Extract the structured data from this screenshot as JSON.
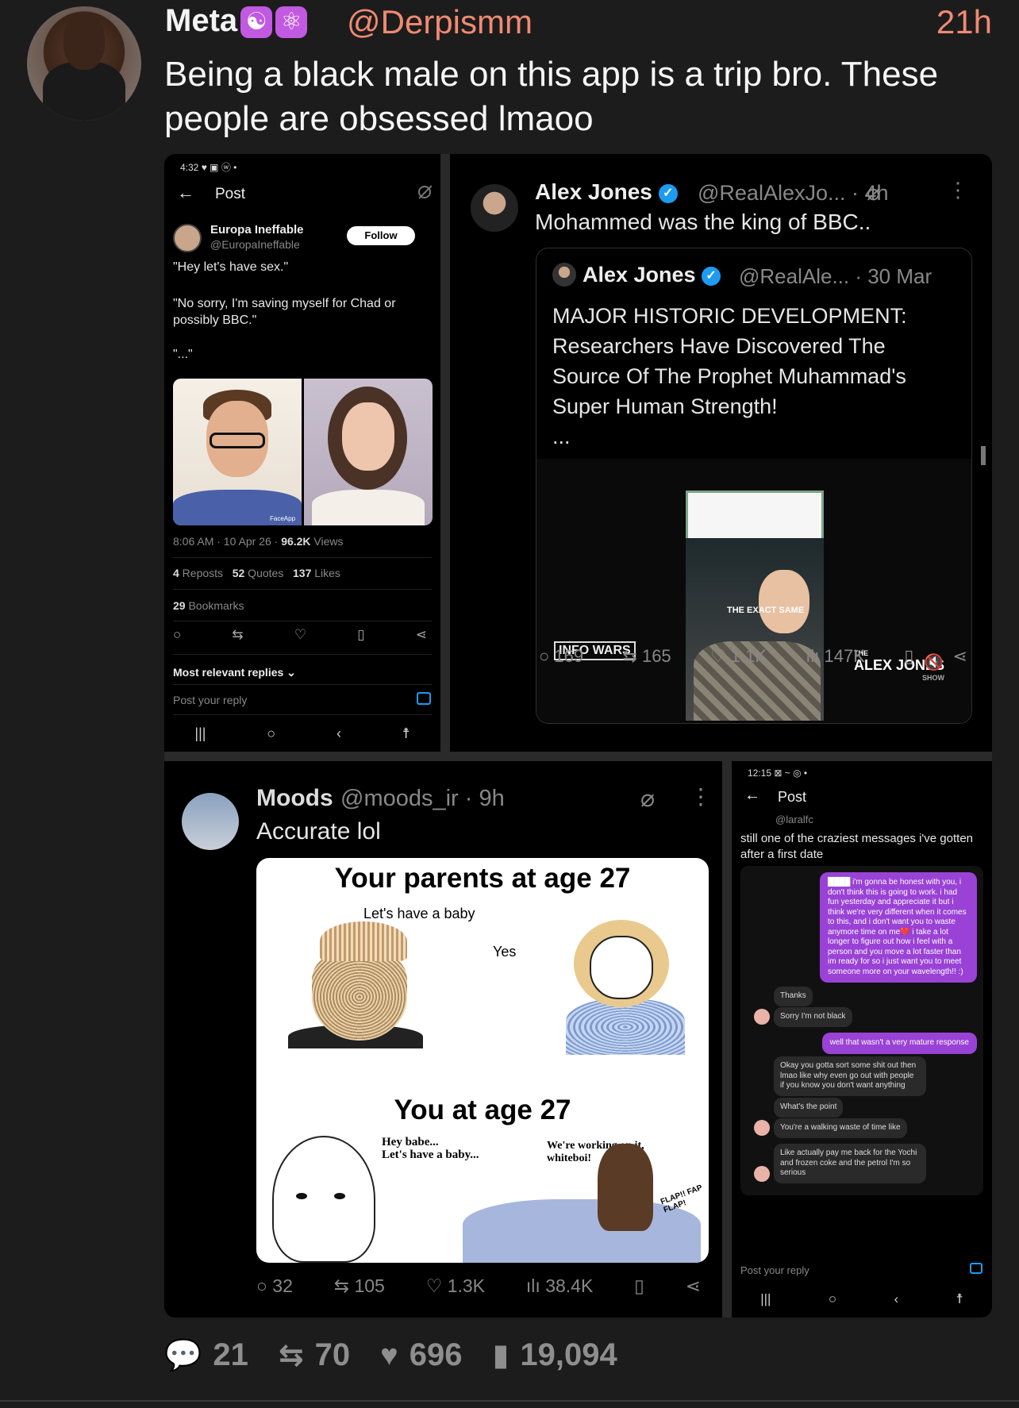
{
  "post": {
    "username": "Meta",
    "badges": [
      "☯",
      "⚛"
    ],
    "handle": "@Derpismm",
    "time": "21h",
    "text": "Being a black male on this app is a trip bro. These people are obsessed lmaoo"
  },
  "panel1": {
    "status_bar": "4:32 ♥ ▣ ⓦ •",
    "title": "Post",
    "author_name": "Europa Ineffable",
    "author_handle": "@EuropaIneffable",
    "follow_label": "Follow",
    "body1": "\"Hey let's have sex.\"",
    "body2": "\"No sorry, I'm saving myself for Chad or possibly BBC.\"",
    "body3": "\"...\"",
    "image_watermark": "FaceApp",
    "meta_time": "8:06 AM · 10 Apr 26 · ",
    "views_value": "96.2K",
    "views_label": " Views",
    "reposts_value": "4",
    "reposts_label": " Reposts",
    "quotes_value": "52",
    "quotes_label": " Quotes",
    "likes_value": "137",
    "likes_label": " Likes",
    "bookmarks_value": "29",
    "bookmarks_label": " Bookmarks",
    "replies_filter": "Most relevant replies ⌄",
    "reply_placeholder": "Post your reply"
  },
  "panel2": {
    "author_name": "Alex Jones",
    "author_handle": "@RealAlexJo... · 4h",
    "text": "Mohammed was the king of BBC..",
    "quote_name": "Alex Jones",
    "quote_handle": "@RealAle... · 30 Mar",
    "quote_text": "MAJOR HISTORIC DEVELOPMENT: Researchers Have Discovered The Source Of The Prophet Muhammad's Super Human Strength!\n...",
    "video_caption": "THE EXACT SAME",
    "infowars_logo": "INFO WARS",
    "show_logo_the": "THE",
    "show_logo": "ALEX JONES",
    "show_logo_show": "SHOW",
    "replies": "169",
    "reposts": "165",
    "likes": "1.1K",
    "views": "147K"
  },
  "panel3": {
    "author_name": "Moods",
    "author_handle": "@moods_ir · 9h",
    "text": "Accurate lol",
    "meme_title1": "Your parents at age 27",
    "meme_q1": "Let's have a baby",
    "meme_q2": "Yes",
    "meme_title2": "You at age 27",
    "meme_q3": "Hey babe...\nLet's have a baby...",
    "meme_q4": "We're working on it,\nwhiteboi!",
    "meme_sfx": "FLAP!! FAP FLAP!",
    "replies": "32",
    "reposts": "105",
    "likes": "1.3K",
    "views": "38.4K"
  },
  "panel4": {
    "status_bar": "12:15 ⊠ ~ ◎ •",
    "title": "Post",
    "author_handle": "@laralfc",
    "caption": "still one of the craziest messages i've gotten after a first date",
    "msg1": "████ i'm gonna be honest with you, i don't think this is going to work. i had fun yesterday and appreciate it but i think we're very different when it comes to this, and i don't want you to waste anymore time on me❤️ i take a lot longer to figure out how i feel with a person and you move a lot faster than im ready for so i just want you to meet someone more on your wavelength!! :)",
    "msg2": "Thanks",
    "msg3": "Sorry I'm not black",
    "msg4": "well that wasn't a very mature response",
    "msg5": "Okay you gotta sort some shit out then lmao like why even go out with people if you know you don't want anything",
    "msg6": "What's the point",
    "msg7": "You're a walking waste of time like",
    "msg8": "Like actually pay me back for the Yochi and frozen coke and the petrol I'm so serious",
    "reply_placeholder": "Post your reply"
  },
  "actions": {
    "replies": "21",
    "reposts": "70",
    "likes": "696",
    "views": "19,094"
  },
  "colors": {
    "background": "#1c1c1c",
    "accent": "#f08a72",
    "verified": "#1d9bf0",
    "chat_purple": "#9a42d6"
  }
}
